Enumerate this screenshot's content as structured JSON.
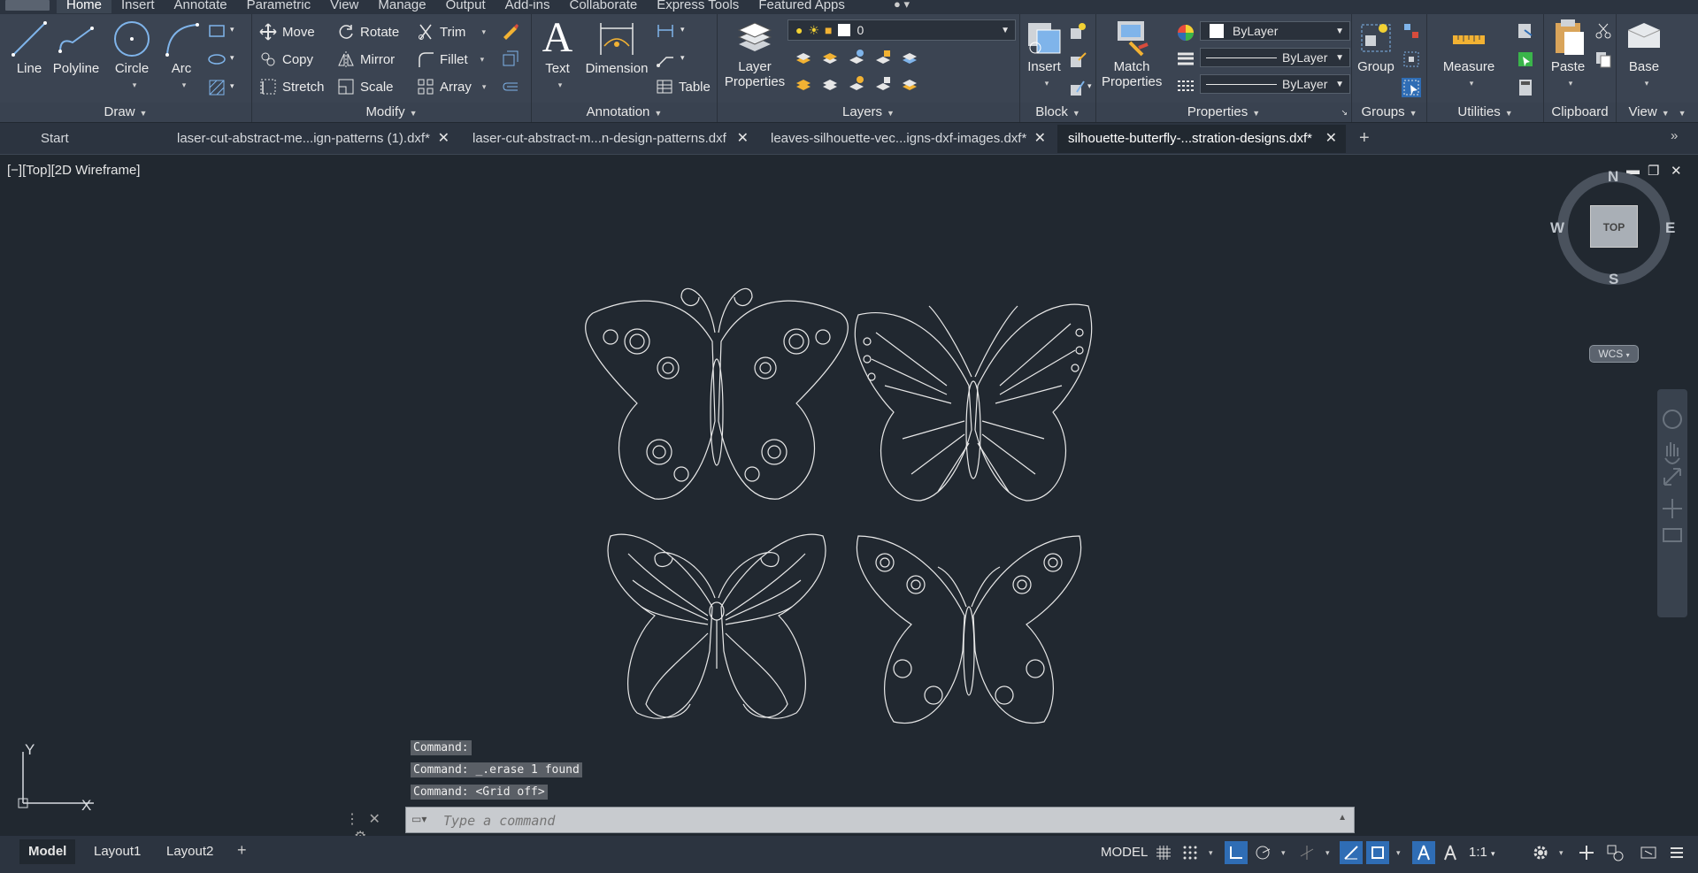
{
  "menu": {
    "tabs": [
      "Home",
      "Insert",
      "Annotate",
      "Parametric",
      "View",
      "Manage",
      "Output",
      "Add-ins",
      "Collaborate",
      "Express Tools",
      "Featured Apps"
    ]
  },
  "ribbon": {
    "draw": {
      "title": "Draw",
      "line": "Line",
      "polyline": "Polyline",
      "circle": "Circle",
      "arc": "Arc"
    },
    "modify": {
      "title": "Modify",
      "move": "Move",
      "rotate": "Rotate",
      "trim": "Trim",
      "copy": "Copy",
      "mirror": "Mirror",
      "fillet": "Fillet",
      "stretch": "Stretch",
      "scale": "Scale",
      "array": "Array"
    },
    "annotation": {
      "title": "Annotation",
      "text": "Text",
      "dimension": "Dimension",
      "table": "Table"
    },
    "layers": {
      "title": "Layers",
      "layer_properties_1": "Layer",
      "layer_properties_2": "Properties",
      "current_layer": "0"
    },
    "block": {
      "title": "Block",
      "insert": "Insert"
    },
    "properties": {
      "title": "Properties",
      "match_1": "Match",
      "match_2": "Properties",
      "color": "ByLayer",
      "linetype": "ByLayer",
      "lineweight": "ByLayer"
    },
    "groups": {
      "title": "Groups",
      "group": "Group"
    },
    "utilities": {
      "title": "Utilities",
      "measure": "Measure"
    },
    "clipboard": {
      "title": "Clipboard",
      "paste": "Paste"
    },
    "view": {
      "title": "View",
      "base": "Base"
    }
  },
  "doc_tabs": [
    "Start",
    "laser-cut-abstract-me...ign-patterns (1).dxf*",
    "laser-cut-abstract-m...n-design-patterns.dxf",
    "leaves-silhouette-vec...igns-dxf-images.dxf*",
    "silhouette-butterfly-...stration-designs.dxf*"
  ],
  "viewport": {
    "label": "[−][Top][2D Wireframe]"
  },
  "viewcube": {
    "n": "N",
    "s": "S",
    "e": "E",
    "w": "W",
    "face": "TOP",
    "wcs": "WCS"
  },
  "ucs": {
    "y": "Y",
    "x": "X"
  },
  "command": {
    "history": [
      "Command:",
      "Command:  _.erase 1 found",
      "Command:  <Grid off>"
    ],
    "placeholder": "Type a command"
  },
  "layout_tabs": [
    "Model",
    "Layout1",
    "Layout2"
  ],
  "status": {
    "space": "MODEL",
    "scale": "1:1"
  },
  "colors": {
    "accent": "#2f6db5",
    "background": "#212830",
    "ribbon": "#3b4452"
  }
}
